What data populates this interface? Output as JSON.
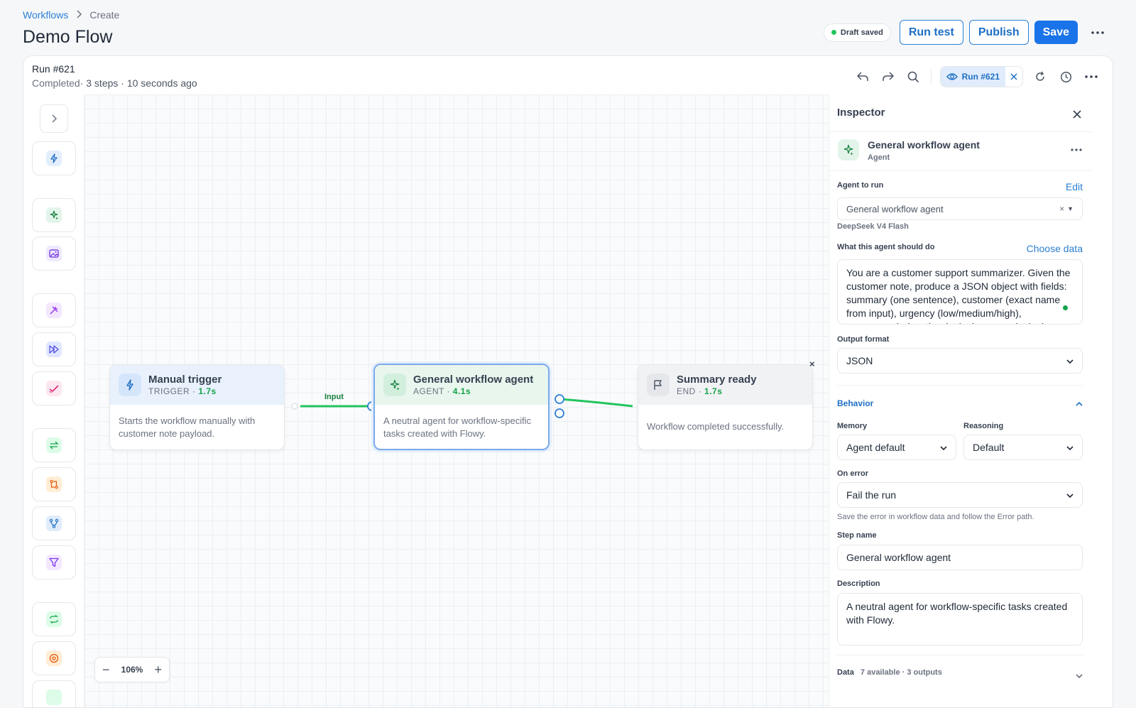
{
  "breadcrumb": {
    "root": "Workflows",
    "current": "Create"
  },
  "page": {
    "title": "Demo Flow"
  },
  "header": {
    "draft_status": "Draft saved",
    "run_test_label": "Run test",
    "publish_label": "Publish",
    "save_label": "Save"
  },
  "run": {
    "title": "Run #621",
    "status": "Completed",
    "summary": "· 3 steps · 10 seconds ago",
    "chip_label": "Run #621"
  },
  "nodes": {
    "trigger": {
      "title": "Manual trigger",
      "type": "TRIGGER",
      "time": "1.7s",
      "description": "Starts the workflow manually with customer note payload."
    },
    "agent": {
      "title": "General workflow agent",
      "type": "AGENT",
      "time": "4.1s",
      "description": "A neutral agent for workflow-specific tasks created with Flowy."
    },
    "end": {
      "title": "Summary ready",
      "type": "END",
      "time": "1.7s",
      "description": "Workflow completed successfully."
    }
  },
  "edge_label": "Input",
  "zoom": {
    "level": "106%"
  },
  "inspector": {
    "title": "Inspector",
    "agent_name": "General workflow agent",
    "agent_type": "Agent",
    "agent_to_run_label": "Agent to run",
    "edit_label": "Edit",
    "agent_select_value": "General workflow agent",
    "model_name": "DeepSeek V4 Flash",
    "instructions_label": "What this agent should do",
    "choose_data_label": "Choose data",
    "instructions_text": "You are a customer support summarizer. Given the customer note, produce a JSON object with fields: summary (one sentence), customer (exact name from input), urgency (low/medium/high), recommended_action (string), reason (string).",
    "output_format_label": "Output format",
    "output_format_value": "JSON",
    "behavior_label": "Behavior",
    "memory_label": "Memory",
    "memory_value": "Agent default",
    "reasoning_label": "Reasoning",
    "reasoning_value": "Default",
    "on_error_label": "On error",
    "on_error_value": "Fail the run",
    "on_error_hint": "Save the error in workflow data and follow the Error path.",
    "step_name_label": "Step name",
    "step_name_value": "General workflow agent",
    "description_label": "Description",
    "description_value": "A neutral agent for workflow-specific tasks created with Flowy.",
    "data_label": "Data",
    "data_meta": "7 available · 3 outputs"
  },
  "colors": {
    "accent": "#1a73e8",
    "link": "#2b7fd3",
    "success": "#22c55e",
    "edge": "#22c55e"
  }
}
